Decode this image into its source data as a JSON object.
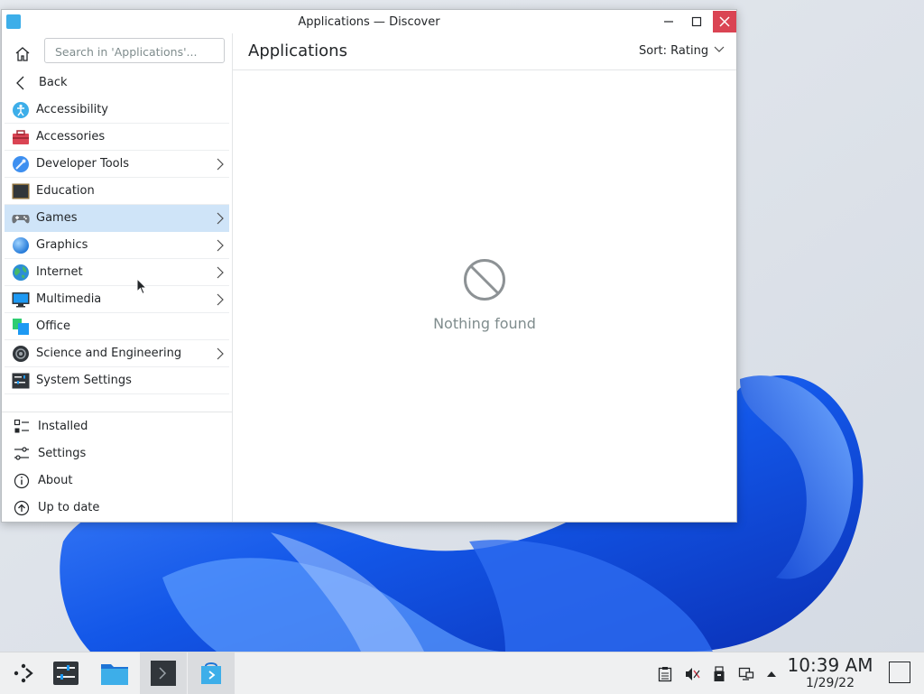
{
  "window": {
    "title": "Applications — Discover"
  },
  "search": {
    "placeholder": "Search in 'Applications'..."
  },
  "nav": {
    "back_label": "Back"
  },
  "categories": [
    {
      "label": "Accessibility",
      "icon": "accessibility-icon",
      "has_children": false
    },
    {
      "label": "Accessories",
      "icon": "toolbox-icon",
      "has_children": false
    },
    {
      "label": "Developer Tools",
      "icon": "developer-tools-icon",
      "has_children": true
    },
    {
      "label": "Education",
      "icon": "chalkboard-icon",
      "has_children": false
    },
    {
      "label": "Games",
      "icon": "gamepad-icon",
      "has_children": true,
      "selected": true
    },
    {
      "label": "Graphics",
      "icon": "graphics-icon",
      "has_children": true
    },
    {
      "label": "Internet",
      "icon": "globe-icon",
      "has_children": true
    },
    {
      "label": "Multimedia",
      "icon": "monitor-icon",
      "has_children": true
    },
    {
      "label": "Office",
      "icon": "office-icon",
      "has_children": false
    },
    {
      "label": "Science and Engineering",
      "icon": "science-icon",
      "has_children": true
    },
    {
      "label": "System Settings",
      "icon": "settings-panel-icon",
      "has_children": false
    }
  ],
  "actions": [
    {
      "label": "Installed",
      "icon": "installed-icon"
    },
    {
      "label": "Settings",
      "icon": "sliders-icon"
    },
    {
      "label": "About",
      "icon": "info-icon"
    },
    {
      "label": "Up to date",
      "icon": "update-icon"
    }
  ],
  "main": {
    "title": "Applications",
    "sort_label": "Sort: Rating",
    "empty_message": "Nothing found"
  },
  "taskbar": {
    "time": "10:39 AM",
    "date": "1/29/22"
  },
  "colors": {
    "accent": "#3daee9",
    "selection": "#cfe4f8",
    "close": "#da4453"
  }
}
